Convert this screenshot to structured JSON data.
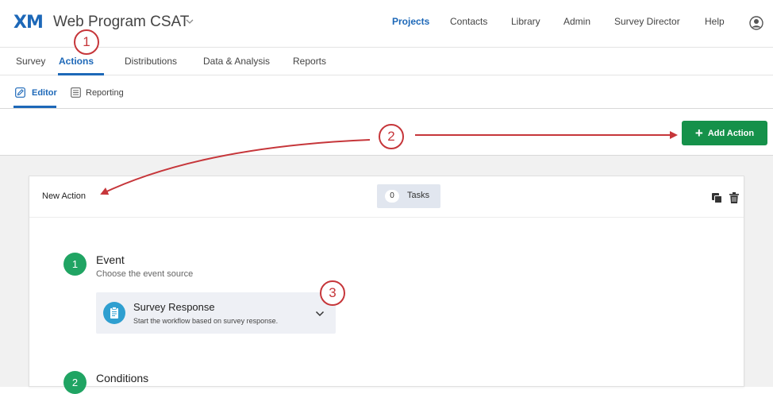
{
  "header": {
    "logo": "XM",
    "project_title": "Web Program CSAT",
    "nav": [
      "Projects",
      "Contacts",
      "Library",
      "Admin",
      "Survey Director",
      "Help"
    ],
    "active_nav": "Projects"
  },
  "tabs": [
    "Survey",
    "Actions",
    "Distributions",
    "Data & Analysis",
    "Reports"
  ],
  "active_tab": "Actions",
  "subtabs": [
    "Editor",
    "Reporting"
  ],
  "active_subtab": "Editor",
  "toolbar": {
    "add_action_label": "Add Action"
  },
  "action_card": {
    "title": "New Action",
    "task_count": "0",
    "tasks_label": "Tasks",
    "steps": [
      {
        "number": "1",
        "title": "Event",
        "subtitle": "Choose the event source"
      },
      {
        "number": "2",
        "title": "Conditions"
      }
    ],
    "event": {
      "title": "Survey Response",
      "description": "Start the workflow based on survey response."
    }
  },
  "callouts": [
    "1",
    "2",
    "3"
  ],
  "colors": {
    "brand_blue": "#1d68b8",
    "button_green": "#15914a",
    "step_green": "#20a463",
    "callout_red": "#c6363a",
    "event_icon_blue": "#2f9fd0"
  },
  "icons": [
    "chevron-down-icon",
    "user-icon",
    "pencil-icon",
    "list-icon",
    "plus-icon",
    "copy-icon",
    "trash-icon",
    "clipboard-icon"
  ]
}
